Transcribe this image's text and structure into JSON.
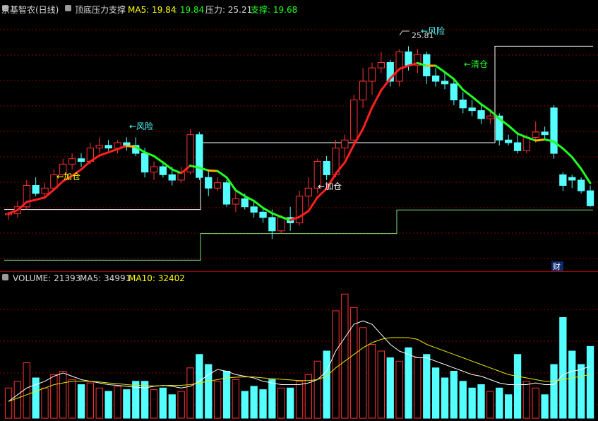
{
  "price_header": {
    "stock": "京基智农(日线)",
    "indicator": "顶底压力支撑",
    "ma5_label": "MA5: 19.84",
    "ma5_value2": "19.84",
    "pressure_label": "压力: 25.21",
    "support_label": "支撑: 19.68"
  },
  "volume_header": {
    "volume_label": "VOLUME: 21393",
    "ma5_label": "MA5: 34991",
    "ma10_label": "MA10: 32402"
  },
  "annotations": {
    "risk": "←风险",
    "add": "←加仓",
    "clear": "←清仓",
    "high_price": "25.81",
    "finance": "财"
  },
  "colors": {
    "up": "#ff3232",
    "down": "#54ffff",
    "ma_up": "#ff2020",
    "ma_flat": "#ffb000",
    "ma_down": "#20ff20",
    "pressure_line": "#ffffff",
    "support_line": "#7de07d",
    "text_yellow": "#ffff00",
    "text_cyan": "#54ffff",
    "text_green": "#20ff20",
    "grid": "#8a0000"
  },
  "chart_data": {
    "type": "candlestick",
    "candles": [
      [
        19.5,
        19.6,
        19.3,
        19.55
      ],
      [
        19.55,
        20.0,
        19.4,
        19.8
      ],
      [
        19.8,
        20.8,
        19.7,
        20.6
      ],
      [
        20.6,
        20.9,
        20.2,
        20.3
      ],
      [
        20.3,
        20.7,
        20.1,
        20.5
      ],
      [
        20.5,
        21.2,
        20.4,
        21.0
      ],
      [
        21.0,
        21.6,
        20.9,
        21.4
      ],
      [
        21.4,
        21.8,
        21.2,
        21.6
      ],
      [
        21.6,
        21.8,
        21.3,
        21.5
      ],
      [
        21.5,
        22.2,
        21.4,
        22.0
      ],
      [
        22.0,
        22.4,
        21.8,
        22.1
      ],
      [
        22.1,
        22.3,
        21.9,
        22.0
      ],
      [
        22.0,
        22.3,
        21.8,
        22.2
      ],
      [
        22.2,
        22.4,
        21.9,
        22.1
      ],
      [
        22.1,
        22.4,
        21.7,
        21.8
      ],
      [
        21.8,
        22.0,
        20.9,
        21.1
      ],
      [
        21.1,
        21.5,
        20.8,
        21.3
      ],
      [
        21.3,
        21.5,
        20.9,
        21.0
      ],
      [
        21.0,
        21.3,
        20.6,
        20.8
      ],
      [
        20.8,
        21.3,
        20.7,
        21.1
      ],
      [
        21.1,
        22.7,
        21.0,
        22.5
      ],
      [
        22.5,
        22.6,
        20.8,
        20.9
      ],
      [
        20.9,
        21.2,
        20.2,
        20.5
      ],
      [
        20.5,
        20.9,
        20.4,
        20.7
      ],
      [
        20.7,
        20.8,
        19.8,
        19.9
      ],
      [
        19.9,
        20.5,
        19.6,
        20.1
      ],
      [
        20.1,
        20.3,
        19.7,
        19.8
      ],
      [
        19.8,
        20.0,
        19.4,
        19.6
      ],
      [
        19.6,
        19.8,
        19.2,
        19.4
      ],
      [
        19.4,
        19.7,
        18.6,
        18.9
      ],
      [
        18.9,
        19.5,
        18.8,
        19.4
      ],
      [
        19.4,
        19.8,
        18.9,
        19.2
      ],
      [
        19.2,
        20.4,
        19.1,
        20.2
      ],
      [
        20.2,
        20.9,
        19.8,
        20.5
      ],
      [
        20.5,
        21.6,
        20.3,
        21.5
      ],
      [
        21.5,
        21.7,
        20.8,
        21.0
      ],
      [
        21.0,
        22.3,
        20.9,
        22.0
      ],
      [
        22.0,
        22.5,
        21.6,
        22.3
      ],
      [
        22.3,
        24.0,
        22.1,
        23.8
      ],
      [
        23.8,
        25.0,
        23.5,
        24.5
      ],
      [
        24.5,
        25.2,
        24.0,
        25.0
      ],
      [
        25.0,
        25.6,
        24.8,
        25.2
      ],
      [
        25.2,
        25.3,
        24.3,
        24.5
      ],
      [
        24.5,
        25.7,
        24.3,
        25.6
      ],
      [
        25.6,
        25.81,
        24.9,
        25.1
      ],
      [
        25.1,
        25.7,
        24.8,
        25.5
      ],
      [
        25.5,
        25.6,
        24.4,
        24.7
      ],
      [
        24.7,
        25.0,
        24.3,
        24.5
      ],
      [
        24.5,
        24.8,
        24.2,
        24.4
      ],
      [
        24.4,
        24.6,
        23.6,
        23.8
      ],
      [
        23.8,
        24.1,
        23.3,
        23.5
      ],
      [
        23.5,
        23.8,
        23.2,
        23.4
      ],
      [
        23.4,
        23.6,
        22.9,
        23.1
      ],
      [
        23.1,
        23.4,
        22.9,
        23.2
      ],
      [
        23.2,
        23.3,
        22.1,
        22.3
      ],
      [
        22.3,
        22.5,
        22.1,
        22.2
      ],
      [
        22.2,
        22.6,
        21.8,
        21.9
      ],
      [
        21.9,
        22.5,
        21.8,
        22.4
      ],
      [
        22.4,
        23.0,
        22.2,
        22.6
      ],
      [
        22.6,
        22.8,
        22.3,
        22.5
      ],
      [
        23.5,
        23.6,
        21.6,
        21.8
      ],
      [
        21.0,
        21.1,
        20.4,
        20.6
      ],
      [
        20.9,
        21.0,
        20.5,
        20.8
      ],
      [
        20.8,
        20.9,
        20.3,
        20.4
      ],
      [
        20.4,
        20.6,
        19.8,
        19.84
      ]
    ],
    "pressure_levels": [
      19.7,
      19.7,
      19.7,
      19.7,
      22.2,
      22.2,
      22.2,
      22.2,
      22.2,
      22.2,
      25.81,
      25.81
    ],
    "support_levels": [
      17.8,
      17.8,
      18.8,
      18.8,
      19.68,
      19.68
    ],
    "ylim": [
      17.6,
      26.8
    ],
    "volume": [
      9000,
      11000,
      16500,
      12000,
      9000,
      13000,
      14000,
      11500,
      10000,
      10500,
      9000,
      8000,
      9500,
      8500,
      11000,
      11000,
      8500,
      9000,
      7000,
      8000,
      15000,
      19000,
      16000,
      11000,
      14000,
      11500,
      8000,
      9500,
      8500,
      11500,
      9000,
      9000,
      11000,
      13000,
      17000,
      20000,
      32000,
      37000,
      33000,
      27000,
      22000,
      20000,
      18000,
      17000,
      21000,
      18000,
      19000,
      15000,
      12000,
      14000,
      11000,
      9000,
      10000,
      8000,
      9000,
      7000,
      19000,
      11000,
      9000,
      7000,
      16000,
      30000,
      20000,
      16000,
      21393
    ],
    "volume_ma5": [
      5000,
      7000,
      9000,
      10000,
      11000,
      12500,
      13500,
      12500,
      11500,
      11000,
      10500,
      10000,
      9800,
      9500,
      9200,
      9000,
      9500,
      9800,
      9500,
      9000,
      9500,
      11000,
      13000,
      14500,
      14000,
      13000,
      12500,
      12000,
      11000,
      10500,
      10000,
      10000,
      10000,
      10500,
      11500,
      14000,
      20000,
      24000,
      28000,
      29000,
      28000,
      25000,
      22000,
      20000,
      19000,
      18000,
      18000,
      17000,
      16000,
      15000,
      14000,
      13000,
      12500,
      11500,
      10500,
      10000,
      10000,
      10000,
      10500,
      10000,
      10000,
      13000,
      14000,
      14500,
      15500
    ],
    "volume_ma10": [
      5000,
      6000,
      7000,
      8000,
      9000,
      10000,
      10500,
      11000,
      11000,
      11000,
      10800,
      10500,
      10300,
      10000,
      9800,
      9700,
      9600,
      9700,
      9800,
      9800,
      10000,
      10500,
      11000,
      11500,
      12000,
      12200,
      12300,
      12300,
      12000,
      11800,
      11600,
      11400,
      11200,
      11200,
      11500,
      12500,
      15000,
      17000,
      19000,
      21000,
      22500,
      23500,
      24000,
      24000,
      24000,
      23500,
      22000,
      21000,
      20000,
      19000,
      18000,
      17000,
      16000,
      15000,
      14000,
      13000,
      12500,
      12000,
      11500,
      11000,
      11000,
      11500,
      12000,
      12500,
      13000
    ],
    "volume_max": 40000
  }
}
